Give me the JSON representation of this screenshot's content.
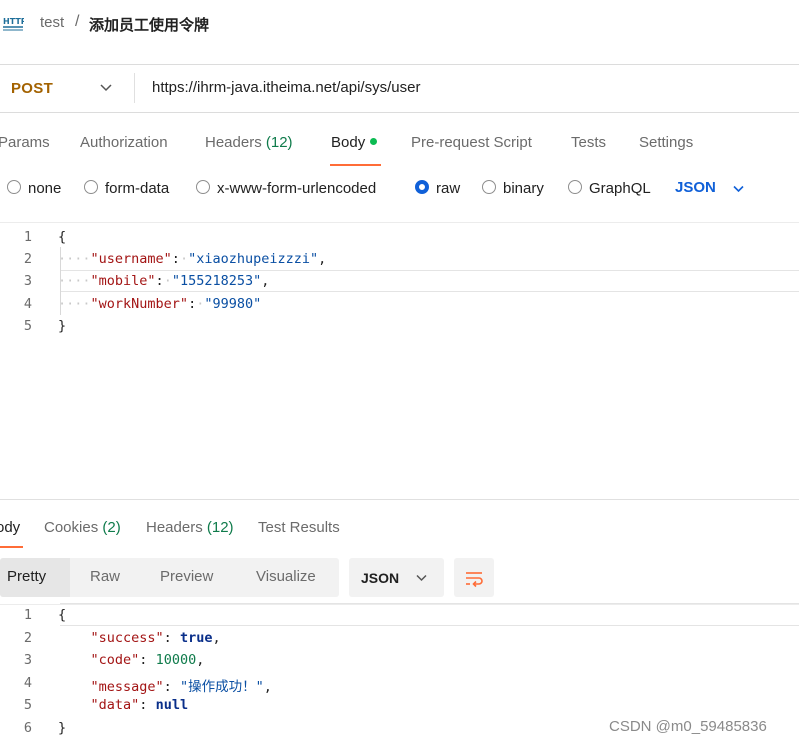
{
  "header": {
    "icon": "http-icon",
    "icon_text": "HTTP",
    "collection": "test",
    "separator": "/",
    "request_name": "添加员工使用令牌"
  },
  "request": {
    "method": "POST",
    "url": "https://ihrm-java.itheima.net/api/sys/user"
  },
  "request_tabs": [
    {
      "label": "Params"
    },
    {
      "label": "Authorization"
    },
    {
      "label": "Headers",
      "count": "(12)"
    },
    {
      "label": "Body",
      "active": true
    },
    {
      "label": "Pre-request Script"
    },
    {
      "label": "Tests"
    },
    {
      "label": "Settings"
    }
  ],
  "body_types": [
    {
      "label": "none",
      "selected": false
    },
    {
      "label": "form-data",
      "selected": false
    },
    {
      "label": "x-www-form-urlencoded",
      "selected": false
    },
    {
      "label": "raw",
      "selected": true
    },
    {
      "label": "binary",
      "selected": false
    },
    {
      "label": "GraphQL",
      "selected": false
    }
  ],
  "raw_format": "JSON",
  "request_body": {
    "line_numbers": [
      "1",
      "2",
      "3",
      "4",
      "5"
    ],
    "open_brace": "{",
    "close_brace": "}",
    "fields": [
      {
        "key": "\"username\"",
        "value": "\"xiaozhupeizzzi\"",
        "comma": ","
      },
      {
        "key": "\"mobile\"",
        "value": "\"155218253\"",
        "comma": ","
      },
      {
        "key": "\"workNumber\"",
        "value": "\"99980\"",
        "comma": ""
      }
    ]
  },
  "response_tabs": [
    {
      "label": "Body",
      "shown": "ody",
      "active": true
    },
    {
      "label": "Cookies",
      "count": "(2)"
    },
    {
      "label": "Headers",
      "count": "(12)"
    },
    {
      "label": "Test Results"
    }
  ],
  "view_modes": [
    {
      "label": "Pretty",
      "active": true
    },
    {
      "label": "Raw"
    },
    {
      "label": "Preview"
    },
    {
      "label": "Visualize"
    }
  ],
  "response_format": "JSON",
  "response_body": {
    "line_numbers": [
      "1",
      "2",
      "3",
      "4",
      "5",
      "6"
    ],
    "open_brace": "{",
    "close_brace": "}",
    "fields": [
      {
        "key": "\"success\"",
        "value": "true",
        "type": "keyword",
        "comma": ","
      },
      {
        "key": "\"code\"",
        "value": "10000",
        "type": "number",
        "comma": ","
      },
      {
        "key": "\"message\"",
        "value": "\"操作成功！\"",
        "type": "string",
        "comma": ","
      },
      {
        "key": "\"data\"",
        "value": "null",
        "type": "keyword",
        "comma": ""
      }
    ]
  },
  "watermark": "CSDN @m0_59485836",
  "colors": {
    "accent": "#ff6c37",
    "method": "#a36200",
    "link_blue": "#1060d8",
    "count_green": "#0f7b4b",
    "active_dot": "#0cbb52"
  }
}
